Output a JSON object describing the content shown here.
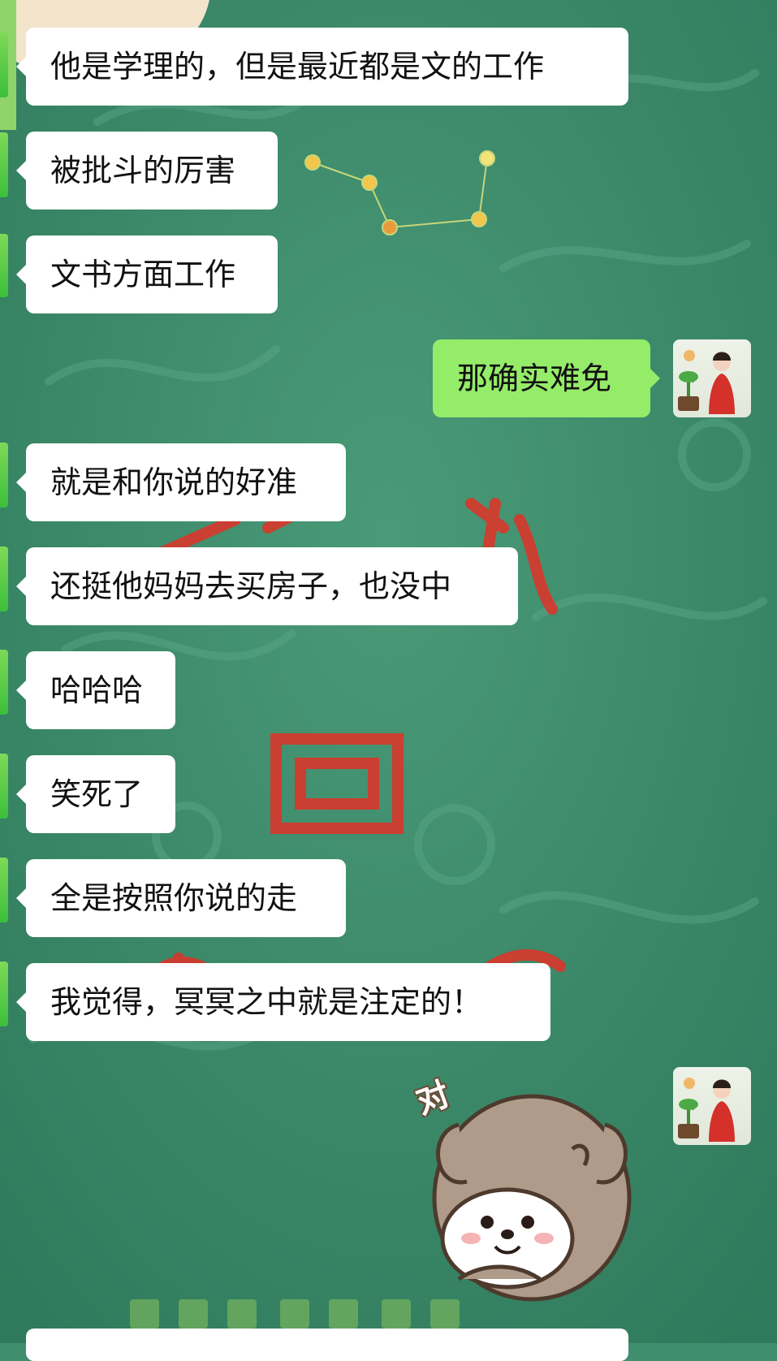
{
  "chat": {
    "messages": [
      {
        "side": "left",
        "text": "他是学理的，但是最近都是文的工作"
      },
      {
        "side": "left",
        "text": "被批斗的厉害"
      },
      {
        "side": "left",
        "text": "文书方面工作"
      },
      {
        "side": "right",
        "text": "那确实难免"
      },
      {
        "side": "left",
        "text": "就是和你说的好准"
      },
      {
        "side": "left",
        "text": "还挺他妈妈去买房子，也没中"
      },
      {
        "side": "left",
        "text": "哈哈哈"
      },
      {
        "side": "left",
        "text": "笑死了"
      },
      {
        "side": "left",
        "text": "全是按照你说的走"
      },
      {
        "side": "left",
        "text": "我觉得，冥冥之中就是注定的！"
      }
    ],
    "sticker": {
      "text": "对",
      "icon": "dog-sticker-icon"
    }
  },
  "colors": {
    "background": "#3f8f6f",
    "incoming_bubble": "#ffffff",
    "outgoing_bubble": "#95ec69",
    "sender_edge": "#58c93a"
  }
}
